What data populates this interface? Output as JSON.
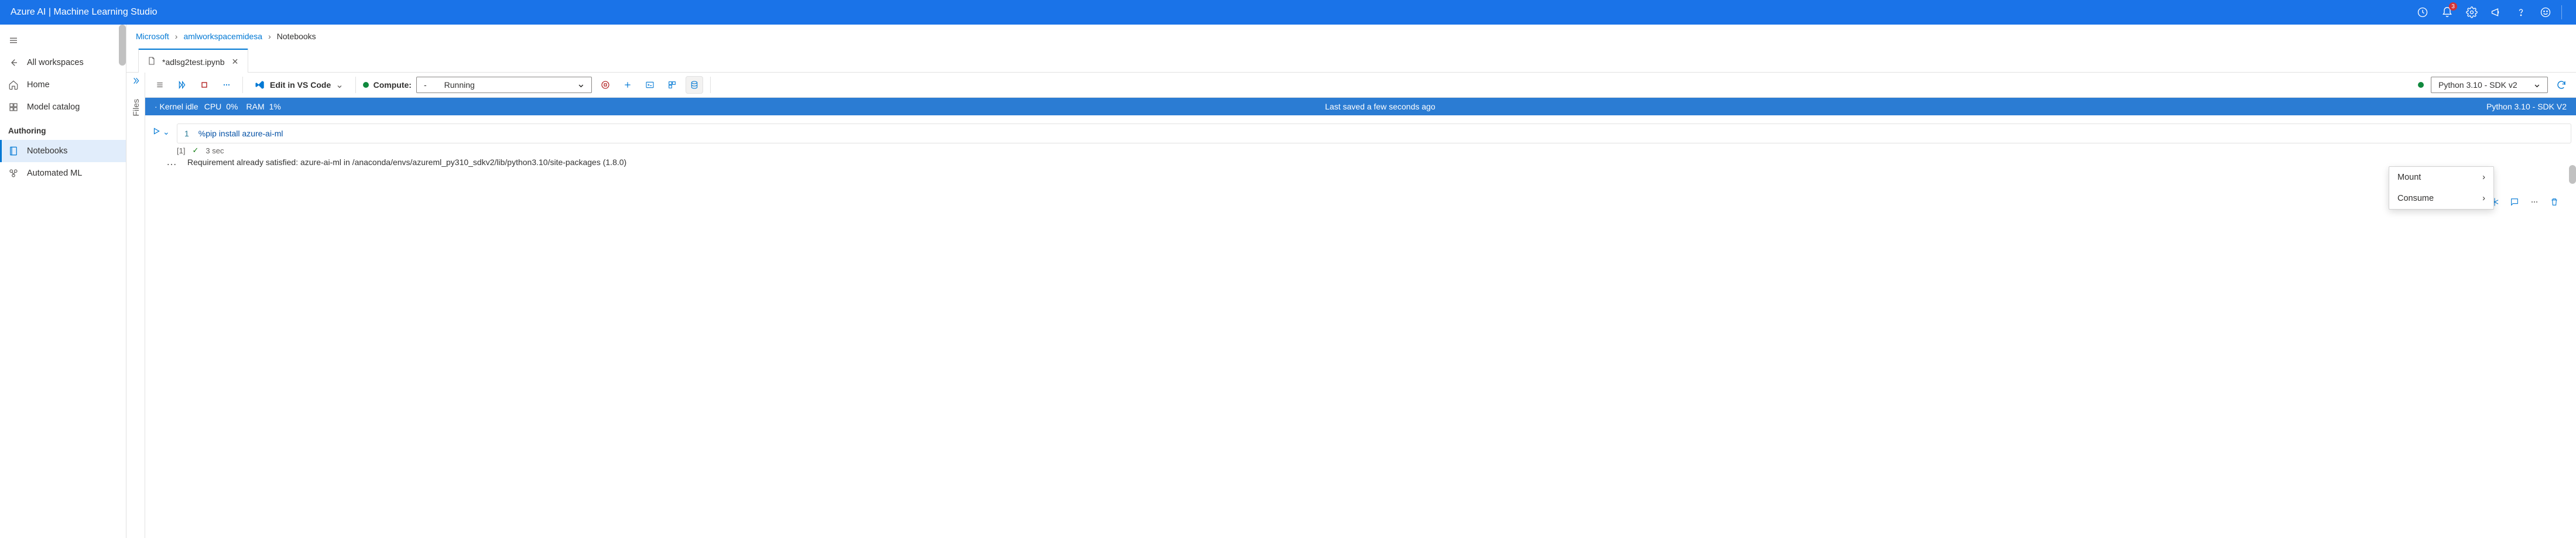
{
  "brand": "Azure AI | Machine Learning Studio",
  "notif_count": "3",
  "sidebar": {
    "all_workspaces": "All workspaces",
    "home": "Home",
    "model_catalog": "Model catalog",
    "authoring_head": "Authoring",
    "notebooks": "Notebooks",
    "automated_ml": "Automated ML"
  },
  "breadcrumb": {
    "root": "Microsoft",
    "ws": "amlworkspacemidesa",
    "cur": "Notebooks"
  },
  "tab": {
    "name": "*adlsg2test.ipynb"
  },
  "files_label": "Files",
  "toolbar": {
    "edit_vscode": "Edit in VS Code",
    "compute_label": "Compute:",
    "compute_status_sep": "-",
    "compute_status": "Running",
    "kernel": "Python 3.10 - SDK v2"
  },
  "infobar": {
    "kernel_status": "· Kernel idle",
    "cpu_lbl": "CPU",
    "cpu_val": "0%",
    "ram_lbl": "RAM",
    "ram_val": "1%",
    "saved": "Last saved a few seconds ago",
    "kernel_right": "Python 3.10 - SDK V2"
  },
  "dropdown": {
    "mount": "Mount",
    "consume": "Consume"
  },
  "cell": {
    "ln": "1",
    "code": "%pip install azure-ai-ml",
    "exec_count": "[1]",
    "duration": "3 sec",
    "output": "Requirement already satisfied: azure-ai-ml in /anaconda/envs/azureml_py310_sdkv2/lib/python3.10/site-packages (1.8.0)"
  }
}
